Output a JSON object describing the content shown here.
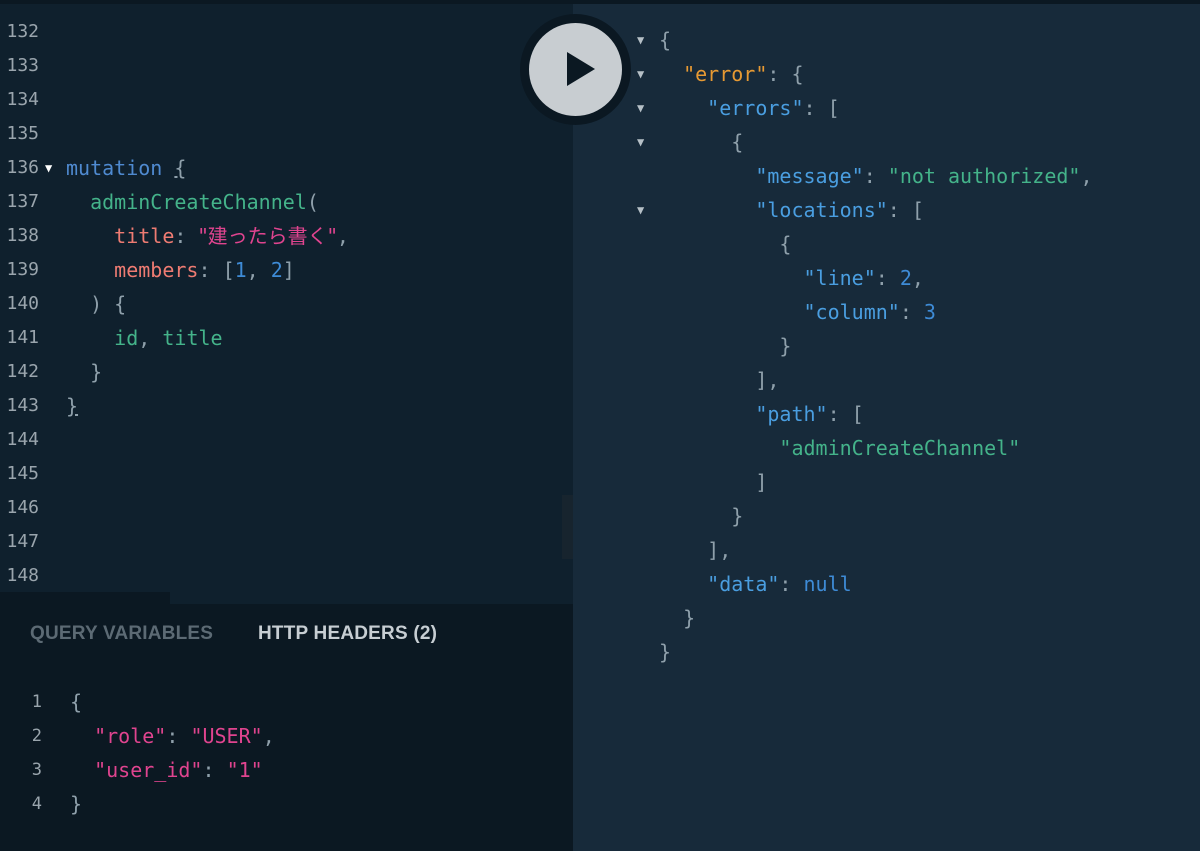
{
  "query_editor": {
    "line_numbers": [
      "132",
      "133",
      "134",
      "135",
      "136",
      "137",
      "138",
      "139",
      "140",
      "141",
      "142",
      "143",
      "144",
      "145",
      "146",
      "147",
      "148"
    ],
    "code": {
      "mutation_keyword": "mutation",
      "open_brace": "{",
      "function_name": "adminCreateChannel",
      "open_paren": "(",
      "title_arg": "title",
      "title_value": "\"建ったら書く\"",
      "members_arg": "members",
      "members_open": "[",
      "member_1": "1",
      "member_2": "2",
      "members_close": "]",
      "close_paren_brace": ") {",
      "field_id": "id",
      "field_title": "title",
      "inner_close": "}",
      "outer_close": "}"
    }
  },
  "bottom_panel": {
    "tabs": {
      "query_variables": "QUERY VARIABLES",
      "http_headers": "HTTP HEADERS (2)"
    },
    "line_numbers": [
      "1",
      "2",
      "3",
      "4"
    ],
    "headers": {
      "open": "{",
      "role_key": "\"role\"",
      "role_value": "\"USER\"",
      "user_id_key": "\"user_id\"",
      "user_id_value": "\"1\"",
      "close": "}"
    }
  },
  "result": {
    "error_key": "\"error\"",
    "errors_key": "\"errors\"",
    "message_key": "\"message\"",
    "message_value": "\"not authorized\"",
    "locations_key": "\"locations\"",
    "line_key": "\"line\"",
    "line_value": "2",
    "column_key": "\"column\"",
    "column_value": "3",
    "path_key": "\"path\"",
    "path_value": "\"adminCreateChannel\"",
    "data_key": "\"data\"",
    "data_value": "null"
  },
  "run_button": {
    "icon": "play-icon"
  }
}
